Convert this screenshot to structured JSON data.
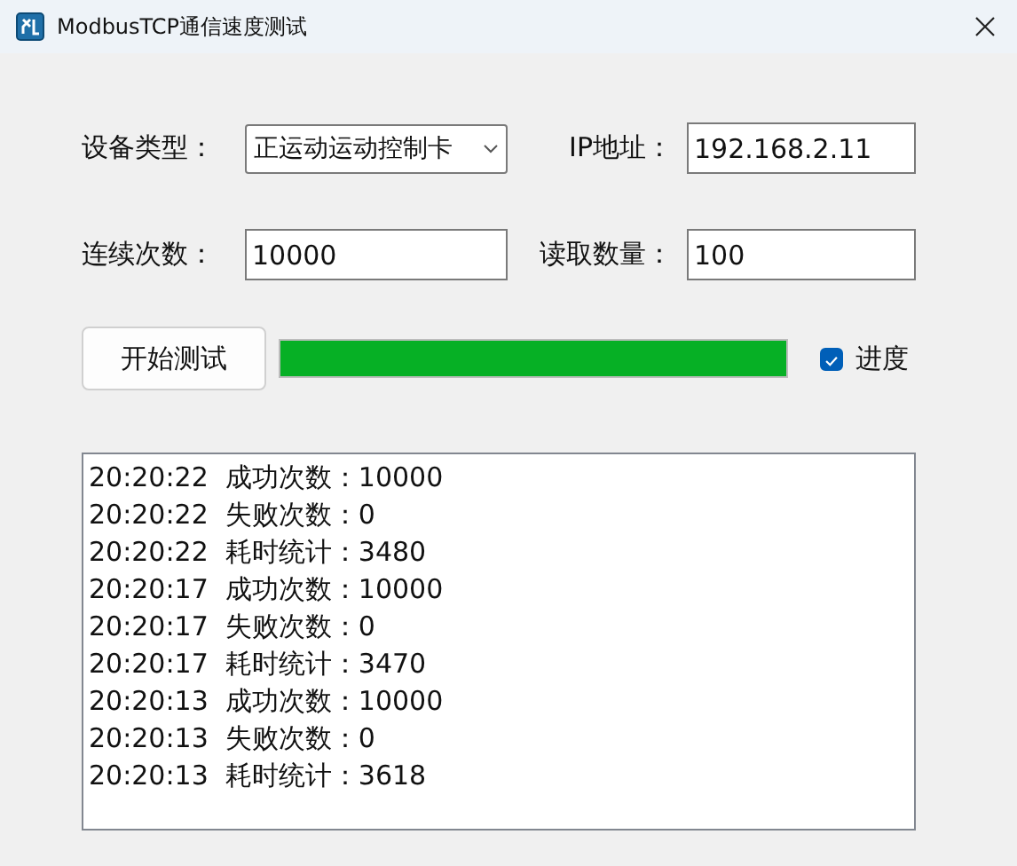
{
  "window": {
    "title": "ModbusTCP通信速度测试"
  },
  "fields": [
    {
      "label": "设备类型：",
      "kind": "dropdown",
      "value": "正运动运动控制卡"
    },
    {
      "label": "IP地址：",
      "kind": "text",
      "value": "192.168.2.11"
    },
    {
      "label": "连续次数：",
      "kind": "text",
      "value": "10000"
    },
    {
      "label": "读取数量：",
      "kind": "text",
      "value": "100"
    }
  ],
  "start_button": "开始测试",
  "progress": {
    "level": 1
  },
  "progress_checkbox": {
    "label": "进度",
    "checked": true
  },
  "log": [
    {
      "time": "20:20:22",
      "text": "成功次数：10000"
    },
    {
      "time": "20:20:22",
      "text": "失败次数：0"
    },
    {
      "time": "20:20:22",
      "text": "耗时统计：3480"
    },
    {
      "time": "20:20:17",
      "text": "成功次数：10000"
    },
    {
      "time": "20:20:17",
      "text": "失败次数：0"
    },
    {
      "time": "20:20:17",
      "text": "耗时统计：3470"
    },
    {
      "time": "20:20:13",
      "text": "成功次数：10000"
    },
    {
      "time": "20:20:13",
      "text": "失败次数：0"
    },
    {
      "time": "20:20:13",
      "text": "耗时统计：3618"
    }
  ]
}
